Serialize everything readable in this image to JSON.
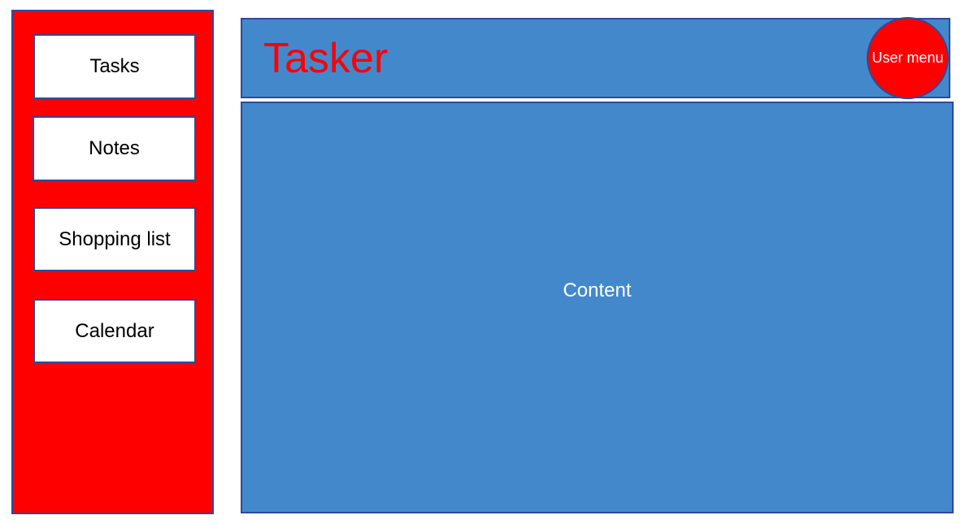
{
  "colors": {
    "sidebar_bg": "#ff0000",
    "panel_bg": "#4488cc",
    "border": "#2f4a9a",
    "title_color": "#ff0000",
    "user_menu_bg": "#ff0000"
  },
  "sidebar": {
    "items": [
      {
        "label": "Tasks"
      },
      {
        "label": "Notes"
      },
      {
        "label": "Shopping list"
      },
      {
        "label": "Calendar"
      }
    ]
  },
  "header": {
    "title": "Tasker",
    "user_menu_label": "User menu"
  },
  "main": {
    "content_label": "Content"
  }
}
